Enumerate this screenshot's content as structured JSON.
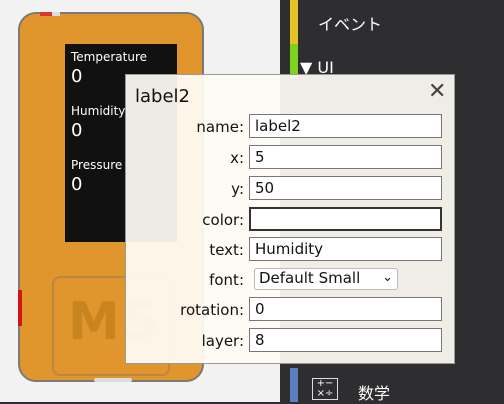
{
  "device": {
    "screen": [
      {
        "label": "Temperature",
        "value": "0"
      },
      {
        "label": "Humidity",
        "value": "0"
      },
      {
        "label": "Pressure",
        "value": "0"
      }
    ],
    "logo": "M5"
  },
  "categories": [
    {
      "label": "イベント",
      "color": "#e6c229"
    },
    {
      "label": "▼ UI",
      "color": "#7ed321"
    },
    {
      "label": "数学",
      "color": "#5b80c0"
    }
  ],
  "dialog": {
    "title": "label2",
    "close_glyph": "✕",
    "fields": {
      "name": {
        "label": "name:",
        "value": "label2"
      },
      "x": {
        "label": "x:",
        "value": "5"
      },
      "y": {
        "label": "y:",
        "value": "50"
      },
      "color": {
        "label": "color:",
        "value": ""
      },
      "text": {
        "label": "text:",
        "value": "Humidity"
      },
      "font": {
        "label": "font:",
        "value": "Default Small"
      },
      "rotation": {
        "label": "rotation:",
        "value": "0"
      },
      "layer": {
        "label": "layer:",
        "value": "8"
      }
    }
  }
}
